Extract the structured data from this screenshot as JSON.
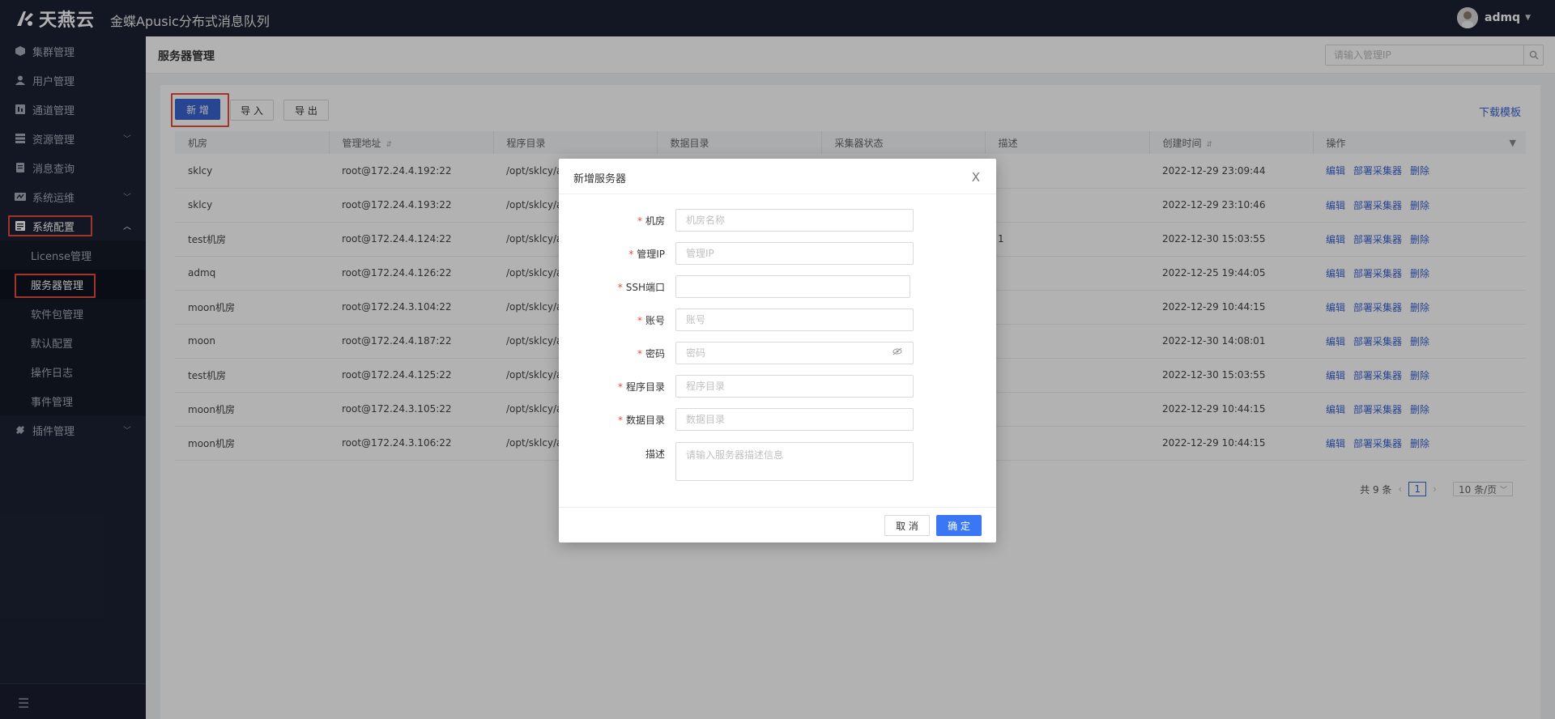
{
  "brand": {
    "name": "天燕云",
    "app_title": "金蝶Apusic分布式消息队列"
  },
  "user": {
    "name": "admq"
  },
  "sidebar": {
    "items": [
      {
        "label": "集群管理",
        "icon": "cube-icon"
      },
      {
        "label": "用户管理",
        "icon": "user-icon"
      },
      {
        "label": "通道管理",
        "icon": "channel-icon"
      },
      {
        "label": "资源管理",
        "icon": "resource-icon"
      },
      {
        "label": "消息查询",
        "icon": "message-icon"
      },
      {
        "label": "系统运维",
        "icon": "ops-icon"
      },
      {
        "label": "系统配置",
        "icon": "config-icon"
      },
      {
        "label": "插件管理",
        "icon": "plugin-icon"
      }
    ],
    "sub_items": [
      "License管理",
      "服务器管理",
      "软件包管理",
      "默认配置",
      "操作日志",
      "事件管理"
    ]
  },
  "page": {
    "title": "服务器管理",
    "search_placeholder": "请输入管理IP"
  },
  "toolbar": {
    "add": "新 增",
    "import": "导 入",
    "export": "导 出",
    "download": "下载模板"
  },
  "table": {
    "headers": [
      "机房",
      "管理地址",
      "程序目录",
      "数据目录",
      "采集器状态",
      "描述",
      "创建时间",
      "操作"
    ],
    "rows": [
      [
        "sklcy",
        "root@172.24.4.192:22",
        "/opt/sklcy/a",
        "",
        "",
        "",
        "2022-12-29 23:09:44"
      ],
      [
        "sklcy",
        "root@172.24.4.193:22",
        "/opt/sklcy/a",
        "",
        "",
        "",
        "2022-12-29 23:10:46"
      ],
      [
        "test机房",
        "root@172.24.4.124:22",
        "/opt/sklcy/a",
        "",
        "",
        "1",
        "2022-12-30 15:03:55"
      ],
      [
        "admq",
        "root@172.24.4.126:22",
        "/opt/sklcy/a",
        "",
        "",
        "",
        "2022-12-25 19:44:05"
      ],
      [
        "moon机房",
        "root@172.24.3.104:22",
        "/opt/sklcy/a",
        "",
        "",
        "",
        "2022-12-29 10:44:15"
      ],
      [
        "moon",
        "root@172.24.4.187:22",
        "/opt/sklcy/a",
        "",
        "",
        "",
        "2022-12-30 14:08:01"
      ],
      [
        "test机房",
        "root@172.24.4.125:22",
        "/opt/sklcy/a",
        "",
        "",
        "",
        "2022-12-30 15:03:55"
      ],
      [
        "moon机房",
        "root@172.24.3.105:22",
        "/opt/sklcy/a",
        "",
        "",
        "",
        "2022-12-29 10:44:15"
      ],
      [
        "moon机房",
        "root@172.24.3.106:22",
        "/opt/sklcy/a",
        "",
        "",
        "",
        "2022-12-29 10:44:15"
      ]
    ],
    "actions": [
      "编辑",
      "部署采集器",
      "删除"
    ]
  },
  "pagination": {
    "total": "共 9 条",
    "current": "1",
    "page_size": "10 条/页"
  },
  "modal": {
    "title": "新增服务器",
    "close": "X",
    "fields": [
      {
        "label": "机房",
        "required": true,
        "placeholder": "机房名称",
        "value": ""
      },
      {
        "label": "管理IP",
        "required": true,
        "placeholder": "管理IP",
        "value": ""
      },
      {
        "label": "SSH端口",
        "required": true,
        "placeholder": "",
        "value": ""
      },
      {
        "label": "账号",
        "required": true,
        "placeholder": "账号",
        "value": ""
      },
      {
        "label": "密码",
        "required": true,
        "placeholder": "密码",
        "value": ""
      },
      {
        "label": "程序目录",
        "required": true,
        "placeholder": "程序目录",
        "value": ""
      },
      {
        "label": "数据目录",
        "required": true,
        "placeholder": "数据目录",
        "value": ""
      },
      {
        "label": "描述",
        "required": false,
        "placeholder": "请输入服务器描述信息",
        "value": ""
      }
    ],
    "cancel": "取 消",
    "confirm": "确 定"
  },
  "colors": {
    "primary": "#3a63d1",
    "confirm": "#3a77f5",
    "sidebar_bg": "#1c2234",
    "highlight_border": "#e74c3c"
  }
}
